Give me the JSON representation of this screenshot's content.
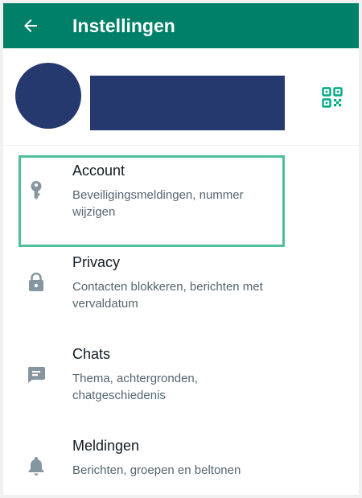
{
  "header": {
    "title": "Instellingen",
    "back_icon": "arrow-back-icon"
  },
  "profile": {
    "avatar_color": "#26396f",
    "name_redacted": true,
    "qr_icon": "qr-code-icon"
  },
  "colors": {
    "app_bar": "#008069",
    "accent": "#00a884",
    "highlight": "#4ebf97",
    "title_text": "#111b21",
    "subtitle_text": "#54656f"
  },
  "settings": {
    "items": [
      {
        "title": "Account",
        "subtitle": "Beveiligingsmeldingen, nummer wijzigen",
        "icon": "key-icon",
        "highlighted": true
      },
      {
        "title": "Privacy",
        "subtitle": "Contacten blokkeren, berichten met vervaldatum",
        "icon": "lock-icon",
        "highlighted": false
      },
      {
        "title": "Chats",
        "subtitle": "Thema, achtergronden, chatgeschiedenis",
        "icon": "chat-icon",
        "highlighted": false
      },
      {
        "title": "Meldingen",
        "subtitle": "Berichten, groepen en beltonen",
        "icon": "bell-icon",
        "highlighted": false
      }
    ]
  }
}
